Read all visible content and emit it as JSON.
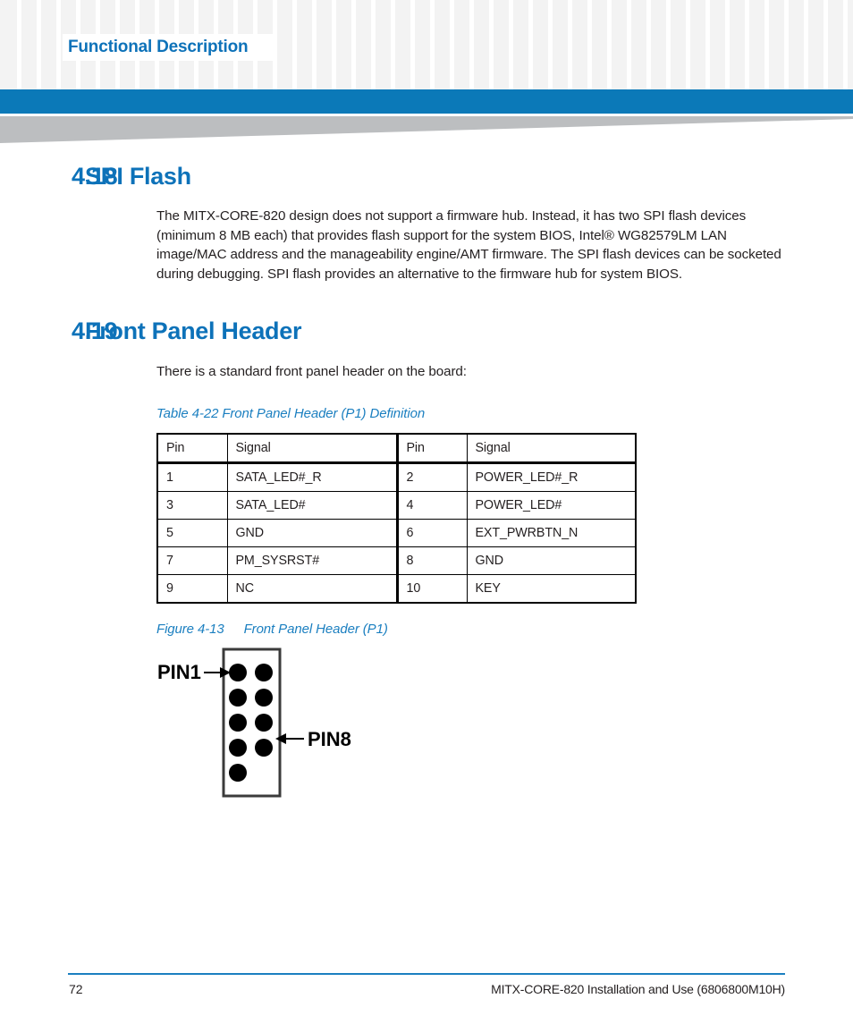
{
  "header": {
    "running_title": "Functional Description",
    "accent_color": "#0b79b8",
    "pattern_color": "#f3f3f3",
    "wedge_color": "#bcbec0"
  },
  "sections": [
    {
      "number": "4.18",
      "title": "SPI Flash",
      "paragraph": "The MITX-CORE-820 design does not support a firmware hub. Instead, it has two SPI flash devices (minimum 8 MB each) that provides flash support for the system BIOS, Intel® WG82579LM LAN image/MAC address and the manageability engine/AMT firmware. The SPI flash devices can be socketed during debugging. SPI flash provides an alternative to the firmware hub for system BIOS."
    },
    {
      "number": "4.19",
      "title": "Front Panel Header",
      "paragraph": "There is a standard front panel header on the board:"
    }
  ],
  "table": {
    "caption_id": "Table 4-22",
    "caption_text": "Front Panel Header (P1) Definition",
    "headers": [
      "Pin",
      "Signal",
      "Pin",
      "Signal"
    ],
    "rows": [
      [
        "1",
        "SATA_LED#_R",
        "2",
        "POWER_LED#_R"
      ],
      [
        "3",
        "SATA_LED#",
        "4",
        "POWER_LED#"
      ],
      [
        "5",
        "GND",
        "6",
        "EXT_PWRBTN_N"
      ],
      [
        "7",
        "PM_SYSRST#",
        "8",
        "GND"
      ],
      [
        "9",
        "NC",
        "10",
        "KEY"
      ]
    ]
  },
  "figure": {
    "caption_id": "Figure 4-13",
    "caption_text": "Front Panel Header (P1)",
    "label_pin1": "PIN1",
    "label_pin8": "PIN8",
    "pin_count": 9,
    "rows": 5,
    "columns": 2
  },
  "footer": {
    "page_number": "72",
    "document_title": "MITX-CORE-820 Installation and Use (6806800M10H)"
  }
}
